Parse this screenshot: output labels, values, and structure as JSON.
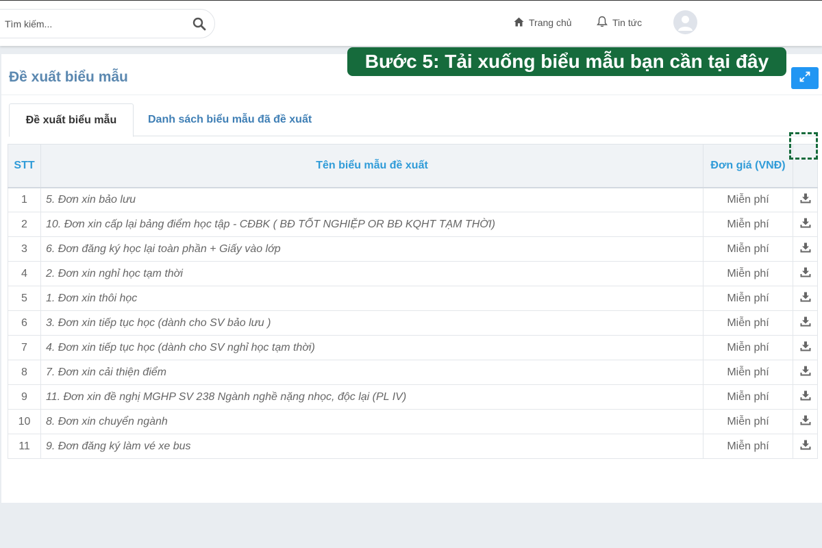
{
  "header": {
    "search_placeholder": "Tìm kiếm...",
    "nav": [
      {
        "label": "Trang chủ",
        "icon": "home-icon"
      },
      {
        "label": "Tin tức",
        "icon": "bell-icon"
      }
    ]
  },
  "page": {
    "title": "Đề xuất biểu mẫu",
    "tabs": [
      {
        "label": "Đề xuất biểu mẫu",
        "active": true
      },
      {
        "label": "Danh sách biểu mẫu đã đề xuất",
        "active": false
      }
    ],
    "callout": "Bước 5: Tải xuống biểu mẫu bạn cần tại đây",
    "accent_color": "#2196f3",
    "callout_color": "#166b3c"
  },
  "table": {
    "headers": {
      "stt": "STT",
      "name": "Tên biểu mẫu đề xuất",
      "price": "Đơn giá (VNĐ)"
    },
    "rows": [
      {
        "stt": "1",
        "name": "5. Đơn xin bảo lưu",
        "price": "Miễn phí"
      },
      {
        "stt": "2",
        "name": "10. Đơn xin cấp lại bảng điểm học tập - CĐBK ( BĐ TỐT NGHIỆP OR BĐ KQHT TẠM THỜI)",
        "price": "Miễn phí"
      },
      {
        "stt": "3",
        "name": "6. Đơn đăng ký học lại toàn phần + Giấy vào lớp",
        "price": "Miễn phí"
      },
      {
        "stt": "4",
        "name": "2. Đơn xin nghỉ học tạm thời",
        "price": "Miễn phí"
      },
      {
        "stt": "5",
        "name": "1. Đơn xin thôi học",
        "price": "Miễn phí"
      },
      {
        "stt": "6",
        "name": "3. Đơn xin tiếp tục học (dành cho SV bảo lưu )",
        "price": "Miễn phí"
      },
      {
        "stt": "7",
        "name": "4. Đơn xin tiếp tục học (dành cho SV nghỉ học tạm thời)",
        "price": "Miễn phí"
      },
      {
        "stt": "8",
        "name": "7. Đơn xin cải thiện điểm",
        "price": "Miễn phí"
      },
      {
        "stt": "9",
        "name": "11. Đơn xin đề nghị MGHP SV 238 Ngành nghề nặng nhọc, độc lại (PL IV)",
        "price": "Miễn phí"
      },
      {
        "stt": "10",
        "name": "8. Đơn xin chuyển ngành",
        "price": "Miễn phí"
      },
      {
        "stt": "11",
        "name": "9. Đơn đăng ký làm vé xe bus",
        "price": "Miễn phí"
      }
    ]
  }
}
